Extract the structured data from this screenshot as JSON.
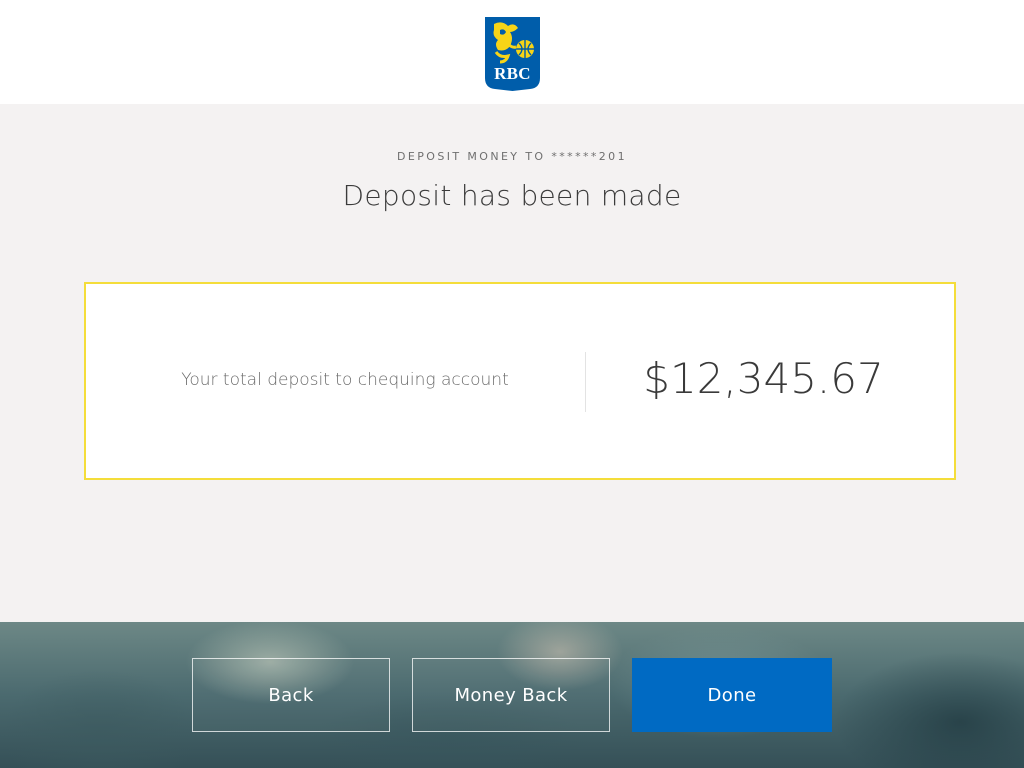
{
  "header": {
    "logo_text": "RBC",
    "logo_colors": {
      "shield": "#005daa",
      "lion": "#f7d417"
    }
  },
  "main": {
    "eyebrow": "DEPOSIT MONEY TO ******201",
    "title": "Deposit has been made",
    "summary": {
      "label": "Your total deposit to chequing account",
      "amount": "$12,345.67",
      "border_color": "#f4dd3a"
    }
  },
  "footer": {
    "buttons": {
      "back": "Back",
      "money_back": "Money Back",
      "done": "Done"
    },
    "primary_color": "#006ac3"
  }
}
